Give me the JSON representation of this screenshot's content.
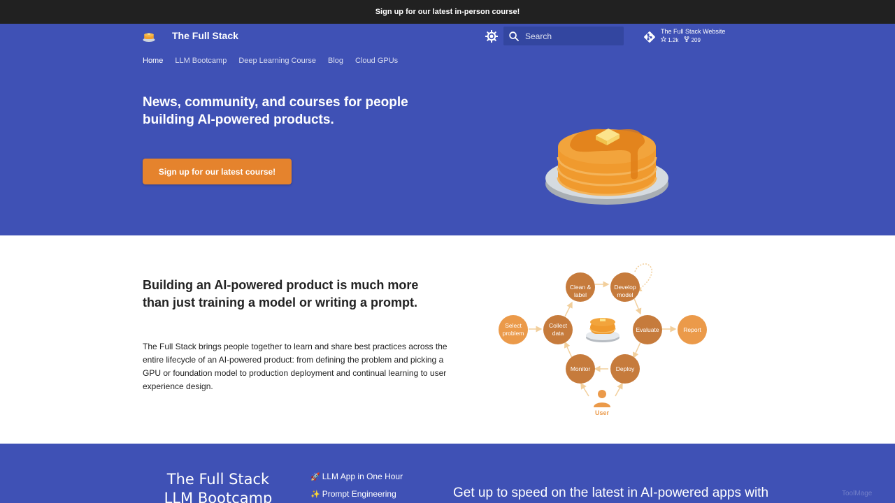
{
  "announcement": "Sign up for our latest in-person course!",
  "header": {
    "title": "The Full Stack",
    "search_placeholder": "Search",
    "repo": {
      "name": "The Full Stack Website",
      "stars": "1.2k",
      "forks": "209"
    }
  },
  "nav": {
    "tabs": [
      {
        "label": "Home",
        "active": true
      },
      {
        "label": "LLM Bootcamp"
      },
      {
        "label": "Deep Learning Course"
      },
      {
        "label": "Blog"
      },
      {
        "label": "Cloud GPUs"
      }
    ]
  },
  "hero": {
    "headline": "News, community, and courses for people building AI-powered products.",
    "cta": "Sign up for our latest course!"
  },
  "about": {
    "heading": "Building an AI-powered product is much more than just training a model or writing a prompt.",
    "body": "The Full Stack brings people together to learn and share best practices across the entire lifecycle of an AI-powered product: from defining the problem and picking a GPU or foundation model to production deployment and continual learning to user experience design.",
    "diagram": {
      "nodes": {
        "select": [
          "Select",
          "problem"
        ],
        "collect": [
          "Collect",
          "data"
        ],
        "clean": [
          "Clean &",
          "label"
        ],
        "develop": [
          "Develop",
          "model"
        ],
        "evaluate": "Evaluate",
        "report": "Report",
        "deploy": "Deploy",
        "monitor": "Monitor",
        "user": "User"
      }
    }
  },
  "bootcamp": {
    "title_line1": "The Full Stack",
    "title_line2": "LLM Bootcamp",
    "items": [
      {
        "emoji": "🚀",
        "label": "LLM App in One Hour"
      },
      {
        "emoji": "✨",
        "label": "Prompt Engineering"
      }
    ],
    "headline": "Get up to speed on the latest in AI-powered apps with"
  },
  "watermark": "ToolMage",
  "colors": {
    "primary": "#3f51b5",
    "accent": "#e5832d",
    "announcement_bg": "#212121",
    "node_dark": "#c67b3c",
    "node_light": "#eb9a4a"
  }
}
